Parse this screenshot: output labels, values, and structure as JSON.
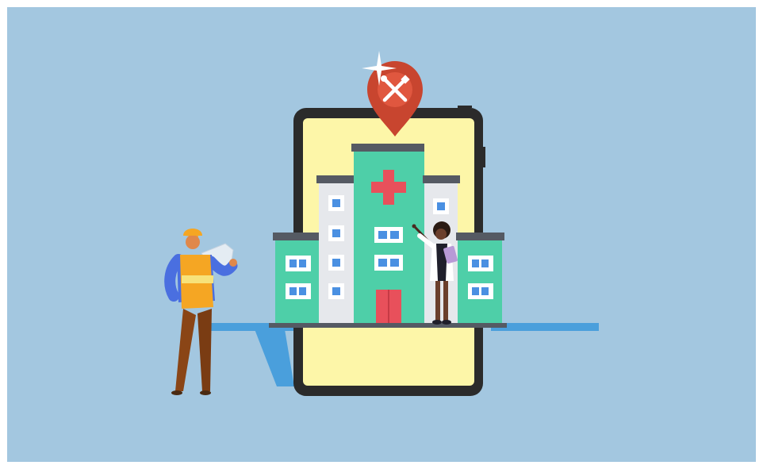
{
  "scene": {
    "background_color": "#a3c7e0",
    "tablet_screen_color": "#fdf6a8",
    "building_color": "#4ecfa8",
    "pin_color": "#c8452f",
    "cross_color": "#e8505b",
    "ground_color": "#4a9fdc"
  },
  "icons": {
    "map_pin": "map-pin-icon",
    "tools": "wrench-screwdriver-icon",
    "medical_cross": "medical-cross-icon",
    "sparkle": "sparkle-icon"
  }
}
